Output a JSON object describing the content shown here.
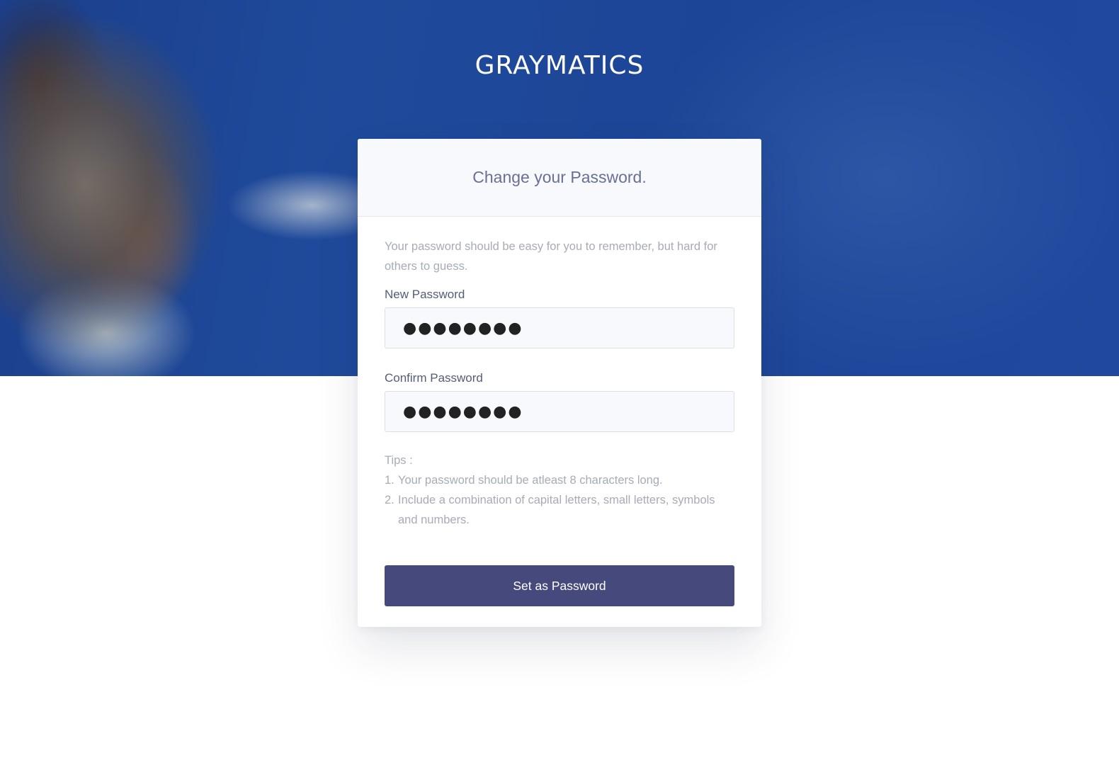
{
  "brand": {
    "logo_text": "GRAYMATICS"
  },
  "form": {
    "title": "Change your Password.",
    "intro": "Your password should be easy for you to remember, but hard for others to guess.",
    "new_password": {
      "label": "New Password",
      "value": "●●●●●●●●"
    },
    "confirm_password": {
      "label": "Confirm Password",
      "value": "●●●●●●●●"
    },
    "tips": {
      "heading": "Tips :",
      "items": [
        {
          "num": "1.",
          "text": "Your password should be atleast 8 characters long."
        },
        {
          "num": "2.",
          "text": "Include a combination of capital letters, small letters, symbols and numbers."
        }
      ]
    },
    "submit_label": "Set as Password"
  },
  "colors": {
    "hero_blue": "#1f4593",
    "button": "#45497b",
    "title_text": "#6a6f94",
    "muted_text": "#a8abb8",
    "label_text": "#555c78"
  }
}
